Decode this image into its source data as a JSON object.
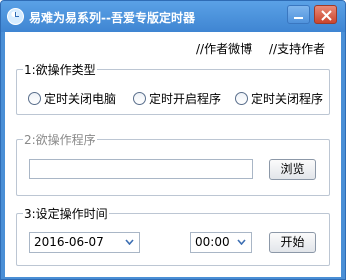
{
  "window": {
    "title": "易难为易系列--吾爱专版定时器",
    "icons": {
      "app": "clock-icon",
      "minimize": "minimize-icon",
      "close": "close-icon"
    }
  },
  "links": {
    "weibo": "//作者微博",
    "support": "//支持作者"
  },
  "operation_type": {
    "legend": "1:欲操作类型",
    "options": [
      "定时关闭电脑",
      "定时开启程序",
      "定时关闭程序"
    ],
    "selected": null
  },
  "program": {
    "legend": "2:欲操作程序",
    "path_value": "",
    "browse_label": "浏览"
  },
  "schedule": {
    "legend": "3:设定操作时间",
    "date_value": "2016-06-07",
    "time_value": "00:00",
    "start_label": "开始"
  },
  "colors": {
    "title_bar": "#4a8fd6",
    "close_button": "#c9452e",
    "group_border": "#bcc6d3",
    "chevron": "#3d6fb3"
  }
}
